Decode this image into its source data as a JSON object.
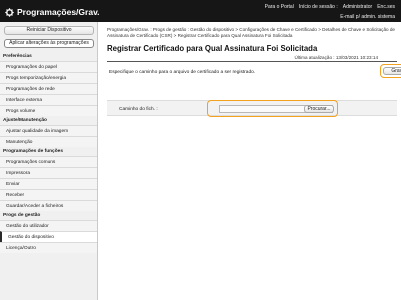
{
  "header": {
    "title": "Programações/Grav.",
    "links": [
      "Para o Portal",
      "Início de sessão :",
      "Administrator",
      "Enc.ses"
    ],
    "email_link": "E-mail p/ admin. sistema"
  },
  "sidebar": {
    "apply_button": "Aplicar alterações às programações",
    "reboot_button": "Reiniciar Dispositivo",
    "sections": [
      {
        "heading": "Preferências",
        "items": [
          "Programações do papel",
          "Progs temporização/energia",
          "Programações de rede",
          "Interface externa",
          "Progs volume"
        ]
      },
      {
        "heading": "Ajuste/Manutenção",
        "items": [
          "Ajustar qualidade da imagem",
          "Manutenção"
        ]
      },
      {
        "heading": "Programações de funções",
        "items": [
          "Programações comuns",
          "Impressora",
          "Enviar",
          "Receber",
          "Guardar/Aceder a ficheiros"
        ]
      },
      {
        "heading": "Progs de gestão",
        "items": [
          "Gestão do utilizador",
          "Gestão do dispositivo",
          "Licença/Outro"
        ]
      }
    ]
  },
  "main": {
    "breadcrumb": "Programações/Grav. : Progs de gestão : Gestão do dispositivo > Configurações de Chave e Certificado > Detalhes de Chave e Solicitação de Assinatura de Certificado (CSR) > Registrar Certificado para Qual Assinatura Foi Solicitada",
    "title": "Registrar Certificado para Qual Assinatura Foi Solicitada",
    "last_update": "Última atualização : 13/03/2021 10:23:14",
    "instruction": "Especifique o caminho para o arquivo de certificado a ser registrado.",
    "register_button": "Gravar",
    "file_path_label": "Caminho do fich. :",
    "file_path_value": "",
    "browse_button": "Procurar..."
  },
  "colors": {
    "header_bg": "#161616",
    "highlight": "#f2a21e",
    "sidebar_bg": "#f0f0f0"
  },
  "icons": {
    "header": "gear-icon"
  }
}
